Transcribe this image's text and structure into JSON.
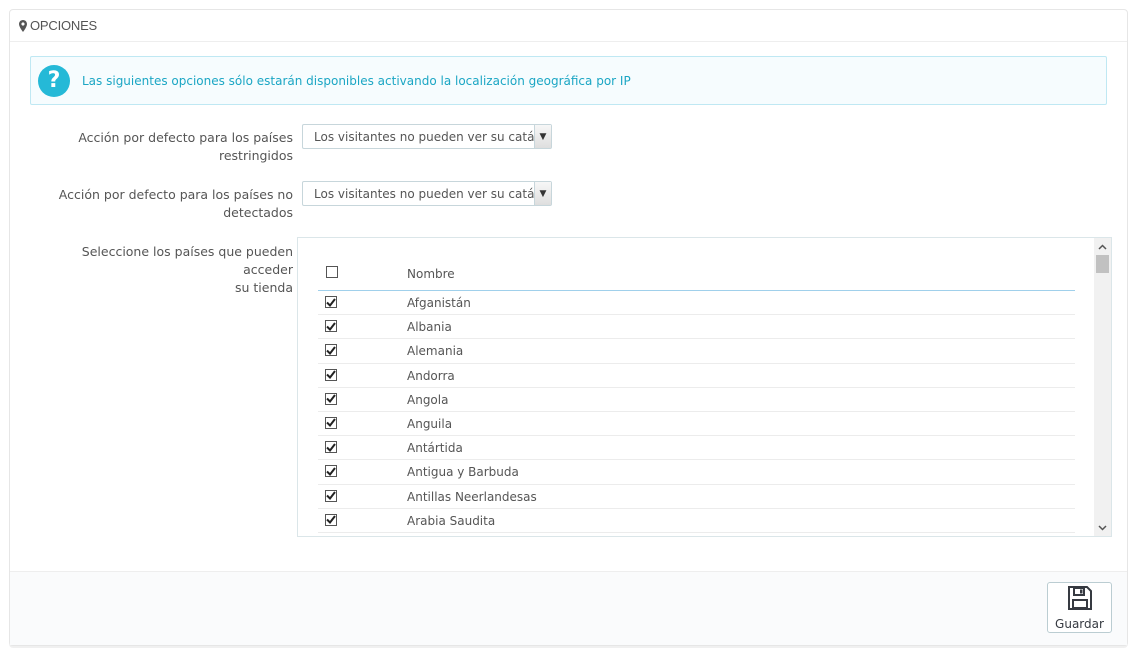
{
  "panel": {
    "title": "OPCIONES",
    "title_icon": "map-marker-icon"
  },
  "alert": {
    "icon": "question-circle-icon",
    "text": "Las siguientes opciones sólo estarán disponibles activando la localización geográfica por IP"
  },
  "fields": {
    "restricted": {
      "label_line1": "Acción por defecto para los países",
      "label_line2": "restringidos",
      "value": "Los visitantes no pueden ver su catálo"
    },
    "undetected": {
      "label_line1": "Acción por defecto para los países no",
      "label_line2": "detectados",
      "value": "Los visitantes no pueden ver su catálo"
    },
    "countries": {
      "label_line1": "Seleccione los países que pueden acceder",
      "label_line2": "su tienda",
      "header_name": "Nombre",
      "header_checked": false,
      "rows": [
        {
          "name": "Afganistán",
          "checked": true
        },
        {
          "name": "Albania",
          "checked": true
        },
        {
          "name": "Alemania",
          "checked": true
        },
        {
          "name": "Andorra",
          "checked": true
        },
        {
          "name": "Angola",
          "checked": true
        },
        {
          "name": "Anguila",
          "checked": true
        },
        {
          "name": "Antártida",
          "checked": true
        },
        {
          "name": "Antigua y Barbuda",
          "checked": true
        },
        {
          "name": "Antillas Neerlandesas",
          "checked": true
        },
        {
          "name": "Arabia Saudita",
          "checked": true
        }
      ]
    }
  },
  "footer": {
    "save_label": "Guardar",
    "save_icon": "floppy-disk-icon"
  },
  "colors": {
    "accent": "#25b9d7",
    "alert_text": "#1ba6c4"
  }
}
